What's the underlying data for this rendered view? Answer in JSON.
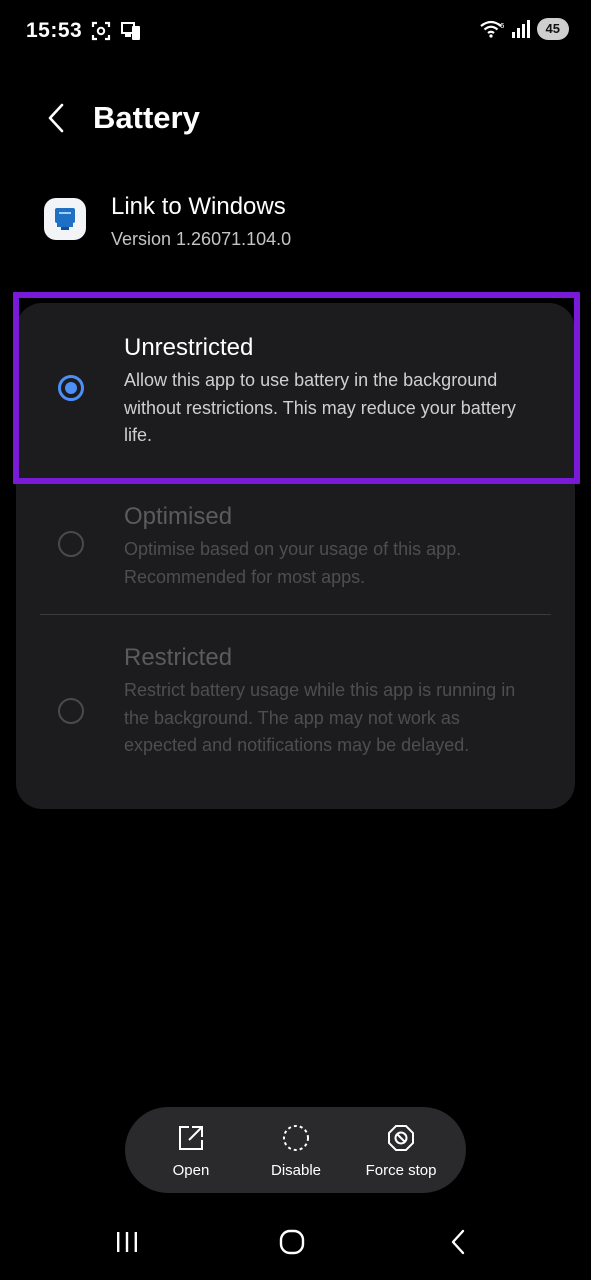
{
  "status_bar": {
    "time": "15:53",
    "battery_level": "45",
    "icons": [
      "screenshot-icon",
      "phone-link-icon",
      "wifi-icon",
      "signal-icon",
      "battery-icon"
    ]
  },
  "header": {
    "title": "Battery"
  },
  "app": {
    "name": "Link to Windows",
    "version": "Version 1.26071.104.0"
  },
  "options": [
    {
      "title": "Unrestricted",
      "description": "Allow this app to use battery in the background without restrictions. This may reduce your battery life.",
      "selected": true
    },
    {
      "title": "Optimised",
      "description": "Optimise based on your usage of this app. Recommended for most apps.",
      "selected": false
    },
    {
      "title": "Restricted",
      "description": "Restrict battery usage while this app is running in the background. The app may not work as expected and notifications may be delayed.",
      "selected": false
    }
  ],
  "actions": {
    "open": "Open",
    "disable": "Disable",
    "force_stop": "Force stop"
  },
  "colors": {
    "accent": "#4c8ff7",
    "highlight": "#7a1ad9",
    "card_bg": "#1c1c1e",
    "background": "#000000"
  }
}
